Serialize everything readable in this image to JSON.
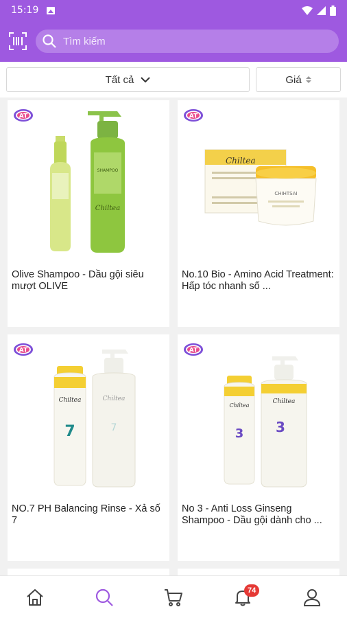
{
  "status_bar": {
    "time": "15:19"
  },
  "header": {
    "search_placeholder": "Tìm kiếm"
  },
  "filters": {
    "category": "Tất cả",
    "price": "Giá"
  },
  "badge_text": "AT",
  "products": [
    {
      "name": "Olive Shampoo - Dầu gội siêu mượt OLIVE",
      "image": "olive-shampoo-bottles"
    },
    {
      "name": "No.10 Bio - Amino Acid Treatment: Hấp tóc nhanh số ...",
      "image": "bio-treatment-jar"
    },
    {
      "name": "NO.7 PH Balancing Rinse - Xả số 7",
      "image": "ph-rinse-bottles"
    },
    {
      "name": " No 3 - Anti Loss Ginseng Shampoo - Dầu gội dành cho ...",
      "image": "ginseng-shampoo-bottles"
    }
  ],
  "bottom_nav": {
    "items": [
      "home",
      "search",
      "cart",
      "notifications",
      "profile"
    ],
    "active": "search",
    "notification_count": "74"
  },
  "colors": {
    "brand": "#9e59e0",
    "badge": "#e53935"
  }
}
